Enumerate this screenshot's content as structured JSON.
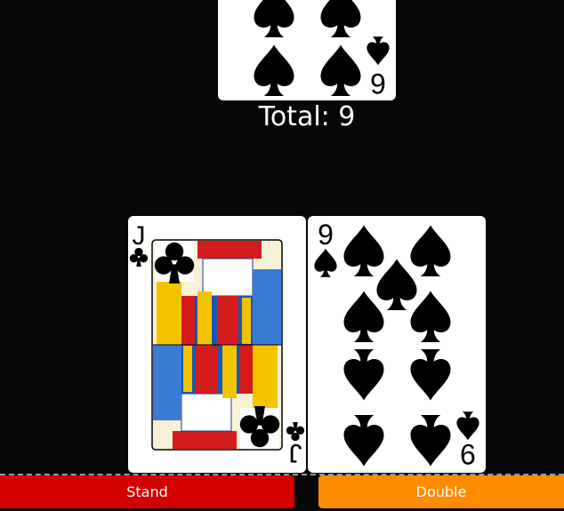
{
  "dealer": {
    "card": {
      "rank": "6",
      "suit": "spades"
    },
    "total_label": "Total: 9"
  },
  "player": {
    "cards": [
      {
        "rank": "J",
        "suit": "clubs"
      },
      {
        "rank": "9",
        "suit": "spades"
      }
    ]
  },
  "actions": {
    "stand_label": "Stand",
    "double_label": "Double"
  },
  "colors": {
    "background": "#070707",
    "stand": "#d20000",
    "double": "#ff8c00"
  }
}
